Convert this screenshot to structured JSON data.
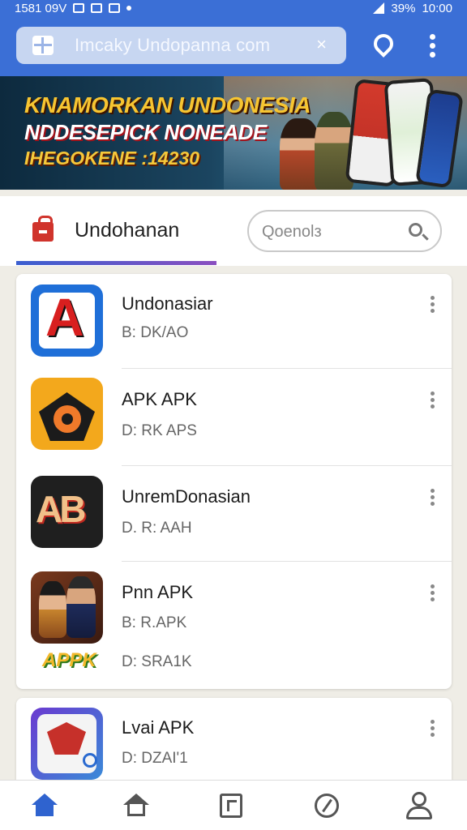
{
  "status_bar": {
    "left_text": "1581 09V",
    "right_text": "39%",
    "time": "10:00"
  },
  "browser": {
    "url_text": "Imcaky Undopanna com",
    "clear_label": "×"
  },
  "banner": {
    "line1": "KNAMORKAN UNDONESIA",
    "line2": "NDDESEPICK NONEADE",
    "line3": "IHEGOKENE :14230"
  },
  "tab": {
    "label": "Undohanan",
    "search_placeholder": "Qoenolз"
  },
  "apps": [
    {
      "title": "Undonasiar",
      "sub1": "B: DK/AO",
      "sub2": "",
      "icon_text": "A"
    },
    {
      "title": "APK APK",
      "sub1": "D: RK APS",
      "sub2": "",
      "icon_text": ""
    },
    {
      "title": "UnremDonasian",
      "sub1": "D. R: AAH",
      "sub2": "",
      "icon_text": "AB"
    },
    {
      "title": "Pnn APK",
      "sub1": "B: R.APK",
      "sub2": "D: SRA1K",
      "icon_text": "APPK"
    },
    {
      "title": "Lvai APK",
      "sub1": "D: DZAI'1",
      "sub2": "",
      "icon_text": ""
    }
  ],
  "colors": {
    "primary": "#3b6fd6",
    "accent_red": "#d0342c",
    "nav_active": "#2f63cf"
  },
  "bottom_nav": [
    "home-icon",
    "house-outline-icon",
    "document-icon",
    "compass-icon",
    "profile-icon"
  ]
}
